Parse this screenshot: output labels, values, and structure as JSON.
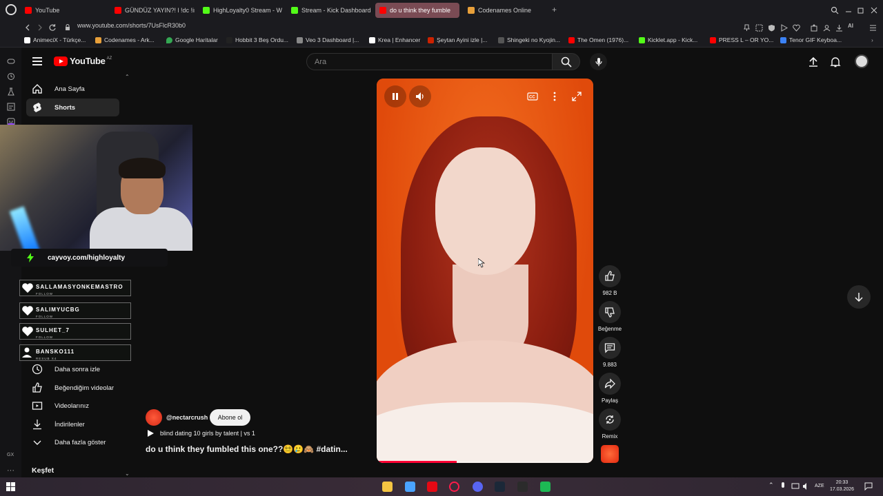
{
  "browser": {
    "tabs": [
      {
        "label": "YouTube",
        "color": "#ff0000"
      },
      {
        "label": "GÜNDÜZ YAYIN?! l !dc !in",
        "color": "#ff0000"
      },
      {
        "label": "HighLoyalty0 Stream - W",
        "color": "#53fc18"
      },
      {
        "label": "Stream - Kick Dashboard",
        "color": "#53fc18"
      },
      {
        "label": "do u think they fumble",
        "color": "#ff0000"
      },
      {
        "label": "Codenames Online",
        "color": "#e8a03a"
      }
    ],
    "url": "www.youtube.com/shorts/7UsFlcR30b0",
    "bookmarks": [
      {
        "label": "AnimeciX - Türkçe...",
        "color": "#ffffff"
      },
      {
        "label": "Codenames - Ark...",
        "color": "#e8a03a"
      },
      {
        "label": "Google Haritalar",
        "color": "#34a853"
      },
      {
        "label": "Hobbit 3 Beş Ordu...",
        "color": "#222222"
      },
      {
        "label": "Veo 3 Dashboard |...",
        "color": "#888888"
      },
      {
        "label": "Krea | Enhancer",
        "color": "#ffffff"
      },
      {
        "label": "Şeytan Ayini izle |...",
        "color": "#cc2200"
      },
      {
        "label": "Shingeki no Kyojin...",
        "color": "#555555"
      },
      {
        "label": "The Omen (1976)...",
        "color": "#ff0000"
      },
      {
        "label": "Kicklet.app - Kick...",
        "color": "#53fc18"
      },
      {
        "label": "PRESS L – OR YO...",
        "color": "#ff0000"
      },
      {
        "label": "Tenor GIF Keyboa...",
        "color": "#3b82f6"
      }
    ],
    "ai_label": "AI"
  },
  "youtube": {
    "logo": "YouTube",
    "country": "AZ",
    "search_placeholder": "Ara",
    "sidebar": {
      "top": [
        {
          "label": "Ana Sayfa",
          "icon": "home-icon"
        },
        {
          "label": "Shorts",
          "icon": "shorts-icon"
        }
      ],
      "lower": [
        {
          "label": "Daha sonra izle",
          "icon": "clock-icon"
        },
        {
          "label": "Beğendiğim videolar",
          "icon": "thumb-up-icon"
        },
        {
          "label": "Videolarınız",
          "icon": "video-icon"
        },
        {
          "label": "İndirilenler",
          "icon": "download-icon"
        },
        {
          "label": "Daha fazla göster",
          "icon": "chevron-down-icon"
        }
      ],
      "explore": "Keşfet"
    },
    "short": {
      "channel": "@nectarcrush",
      "subscribe": "Abone ol",
      "sound": "blind dating 10 girls by talent | vs 1",
      "title": "do u think they fumbled this one??😵‍💫🥲🙈 #datin...",
      "progress": 0.37
    },
    "actions": {
      "likes": "982 B",
      "dislike": "Beğenme",
      "comments": "9.883",
      "share": "Paylaş",
      "remix": "Remix"
    }
  },
  "overlay": {
    "banner": "cayvoy.com/highloyalty",
    "alerts": [
      {
        "name": "SALLAMASYONKEMASTRO",
        "sub": "FOLLOW"
      },
      {
        "name": "SALIMYUCBG",
        "sub": "FOLLOW"
      },
      {
        "name": "SULHET_7",
        "sub": "FOLLOW"
      },
      {
        "name": "BANSKO111",
        "sub": "RESUB X4"
      }
    ]
  },
  "taskbar": {
    "lang": "AZE",
    "time": "20:33",
    "date": "17.03.2026"
  },
  "operabar_label": "GX"
}
